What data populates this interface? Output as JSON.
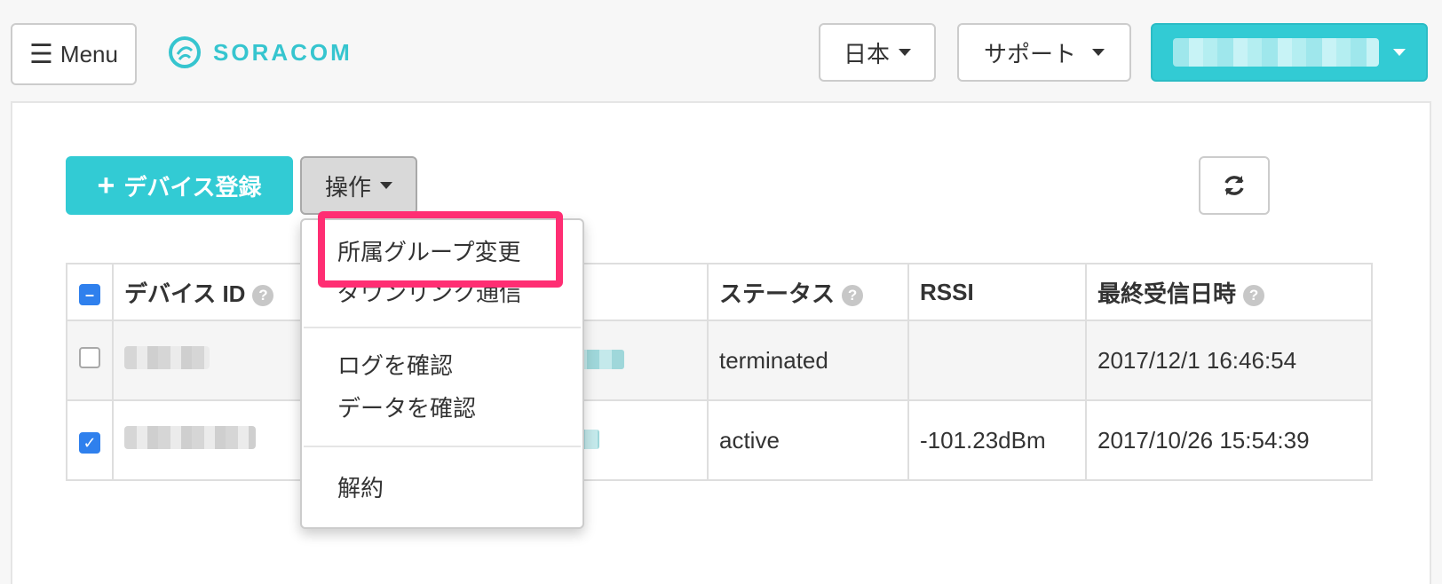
{
  "header": {
    "menu_label": "Menu",
    "logo_text": "SORACOM",
    "language_label": "日本",
    "support_label": "サポート"
  },
  "toolbar": {
    "add_device_label": "デバイス登録",
    "operations_label": "操作"
  },
  "dropdown": {
    "items": [
      "所属グループ変更",
      "ダウンリンク通信",
      "ログを確認",
      "データを確認",
      "解約"
    ]
  },
  "table": {
    "headers": {
      "device_id": "デバイス ID",
      "status": "ステータス",
      "rssi": "RSSI",
      "last_received": "最終受信日時"
    },
    "rows": [
      {
        "checked": false,
        "status": "terminated",
        "rssi": "",
        "last_received": "2017/12/1 16:46:54"
      },
      {
        "checked": true,
        "status": "active",
        "rssi": "-101.23dBm",
        "last_received": "2017/10/26 15:54:39"
      }
    ]
  },
  "colors": {
    "accent": "#32cbd4",
    "highlight": "#ff2e73",
    "checkbox": "#2f80ed"
  }
}
